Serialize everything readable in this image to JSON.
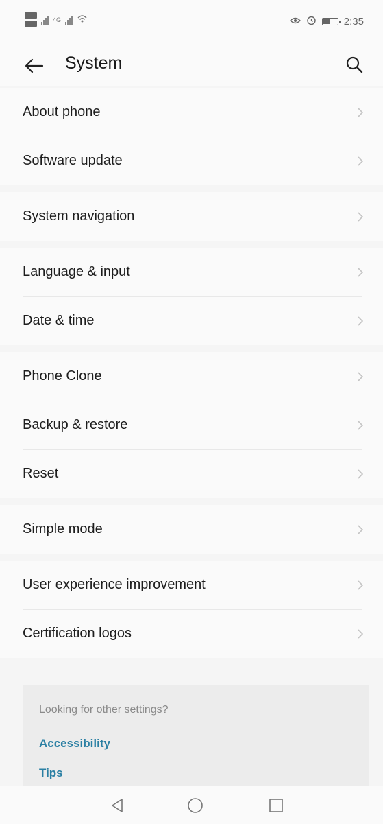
{
  "status_bar": {
    "network_type": "4G",
    "alarm_icon": "alarm-icon",
    "time": "2:35"
  },
  "header": {
    "title": "System",
    "back_icon": "arrow-left-icon",
    "search_icon": "search-icon"
  },
  "groups": [
    {
      "items": [
        {
          "label": "About phone"
        },
        {
          "label": "Software update"
        }
      ]
    },
    {
      "items": [
        {
          "label": "System navigation"
        }
      ]
    },
    {
      "items": [
        {
          "label": "Language & input"
        },
        {
          "label": "Date & time"
        }
      ]
    },
    {
      "items": [
        {
          "label": "Phone Clone"
        },
        {
          "label": "Backup & restore"
        },
        {
          "label": "Reset"
        }
      ]
    },
    {
      "items": [
        {
          "label": "Simple mode"
        }
      ]
    },
    {
      "items": [
        {
          "label": "User experience improvement"
        },
        {
          "label": "Certification logos"
        }
      ]
    }
  ],
  "suggestions": {
    "title": "Looking for other settings?",
    "links": [
      {
        "label": "Accessibility"
      },
      {
        "label": "Tips"
      }
    ]
  },
  "colors": {
    "link": "#2a7fa3",
    "background": "#f5f5f5"
  }
}
